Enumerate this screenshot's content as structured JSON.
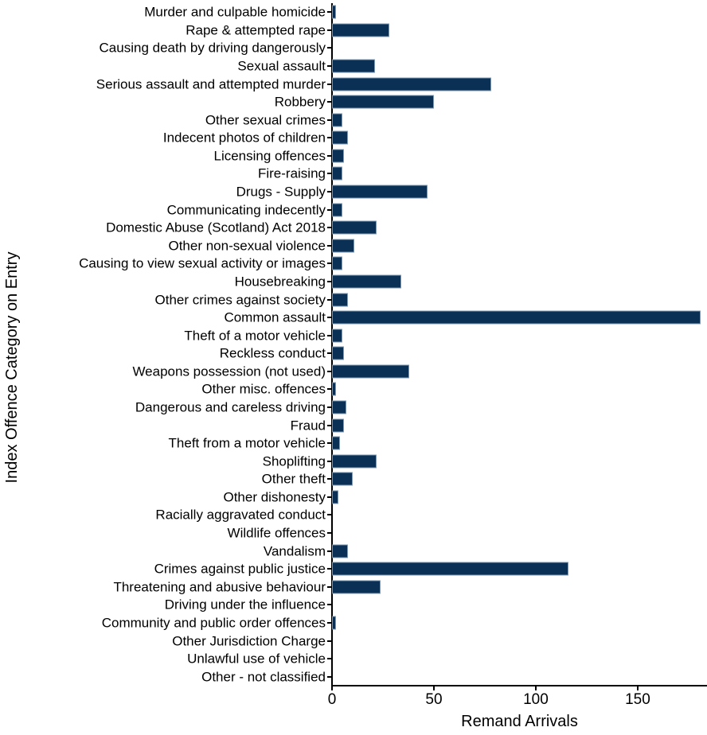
{
  "chart_data": {
    "type": "bar",
    "orientation": "horizontal",
    "title": "",
    "xlabel": "Remand Arrivals",
    "ylabel": "Index Offence Category on Entry",
    "xlim": [
      0,
      184
    ],
    "xticks": [
      0,
      50,
      100,
      150
    ],
    "xtick_labels": [
      "0",
      "50",
      "100",
      "150"
    ],
    "grid": false,
    "legend": null,
    "bar_color": "#0a3055",
    "bar_edge_color": "#7d98b3",
    "categories": [
      "Murder and culpable homicide",
      "Rape & attempted rape",
      "Causing death by driving dangerously",
      "Sexual assault",
      "Serious assault and attempted murder",
      "Robbery",
      "Other sexual crimes",
      "Indecent photos of children",
      "Licensing offences",
      "Fire-raising",
      "Drugs - Supply",
      "Communicating indecently",
      "Domestic Abuse (Scotland) Act 2018",
      "Other non-sexual violence",
      "Causing to view sexual activity or images",
      "Housebreaking",
      "Other crimes against society",
      "Common assault",
      "Theft of a motor vehicle",
      "Reckless conduct",
      "Weapons possession (not used)",
      "Other misc. offences",
      "Dangerous and careless driving",
      "Fraud",
      "Theft from a motor vehicle",
      "Shoplifting",
      "Other theft",
      "Other dishonesty",
      "Racially aggravated conduct",
      "Wildlife offences",
      "Vandalism",
      "Crimes against public justice",
      "Threatening and abusive behaviour",
      "Driving under the influence",
      "Community and public order offences",
      "Other Jurisdiction Charge",
      "Unlawful use of vehicle",
      "Other - not classified"
    ],
    "values": [
      2,
      28,
      0,
      21,
      78,
      50,
      5,
      8,
      6,
      5,
      47,
      5,
      22,
      11,
      5,
      34,
      8,
      181,
      5,
      6,
      38,
      2,
      7,
      6,
      4,
      22,
      10,
      3,
      0,
      0,
      8,
      116,
      24,
      0,
      2,
      0,
      0,
      0
    ]
  }
}
